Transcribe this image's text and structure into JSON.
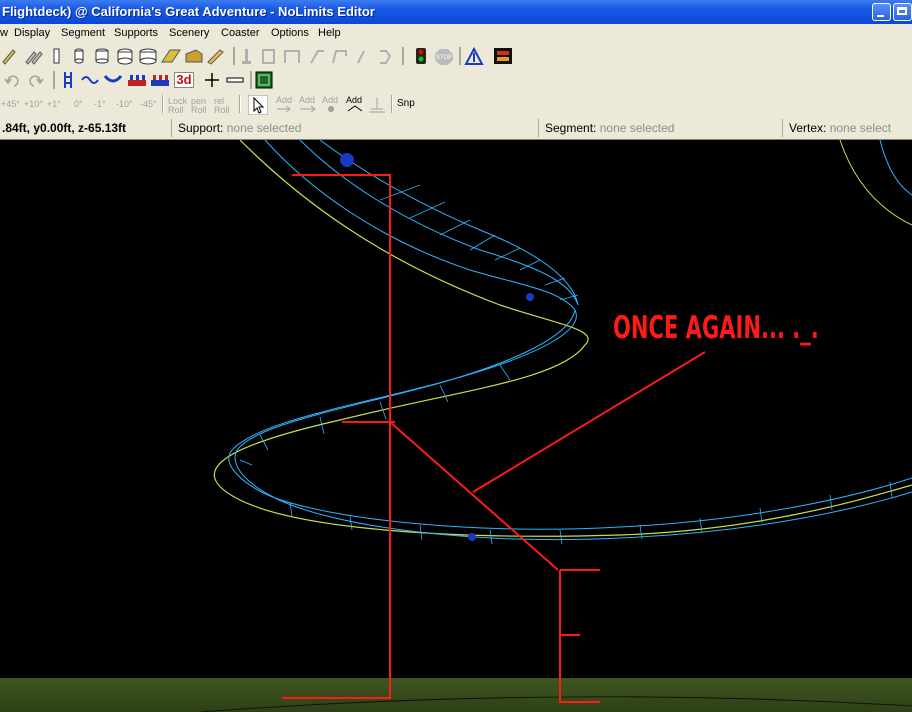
{
  "window": {
    "title": "Flightdeck) @ California's Great Adventure - NoLimits Editor"
  },
  "menu": {
    "items": [
      "w",
      "Display",
      "Segment",
      "Supports",
      "Scenery",
      "Coaster",
      "Options",
      "Help"
    ]
  },
  "toolbar3": {
    "angle_labels": [
      "+45°",
      "+10°",
      "+1°",
      "0°",
      "-1°",
      "-10°",
      "-45°"
    ],
    "lock_roll": "Lock Roll",
    "pen_roll": "pen Roll",
    "rel_roll": "rel Roll",
    "add_labels": [
      "Add",
      "Add",
      "Add",
      "Add"
    ],
    "snap": "Snp"
  },
  "toolbar2": {
    "mode_3d": "3d"
  },
  "status": {
    "coords": ".84ft, y0.00ft, z-65.13ft",
    "support_label": "Support:",
    "support_value": "none selected",
    "segment_label": "Segment:",
    "segment_value": "none selected",
    "vertex_label": "Vertex:",
    "vertex_value": "none select"
  },
  "annotation": {
    "text": "ONCE AGAIN... ._.",
    "color": "#ff1a1a"
  },
  "colors": {
    "track": "#2fb4ff",
    "spine": "#c8e04a",
    "ground": "#3b4f1e"
  }
}
